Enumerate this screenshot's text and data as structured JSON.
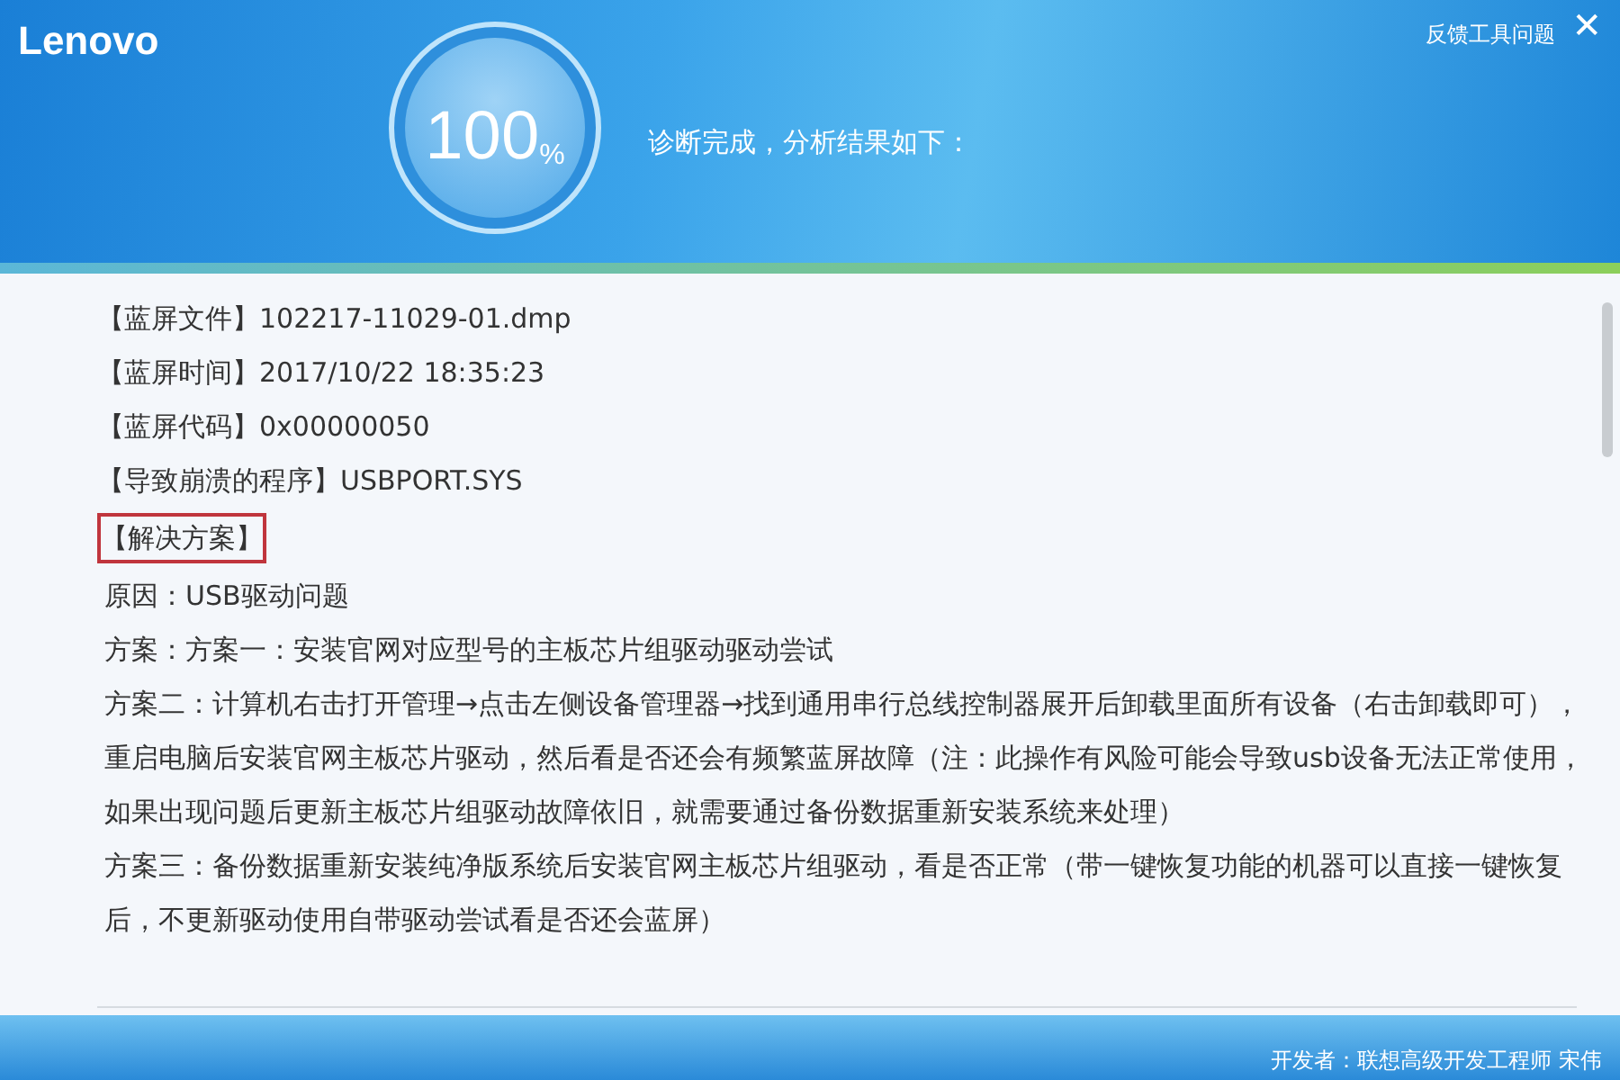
{
  "header": {
    "logo": "Lenovo",
    "progress": {
      "value": "100",
      "unit": "%"
    },
    "status": "诊断完成，分析结果如下：",
    "feedback_link": "反馈工具问题",
    "close": "✕"
  },
  "report": {
    "fields": [
      {
        "label": "【蓝屏文件】",
        "value": "102217-11029-01.dmp"
      },
      {
        "label": "【蓝屏时间】",
        "value": "2017/10/22 18:35:23"
      },
      {
        "label": "【蓝屏代码】",
        "value": "0x00000050"
      },
      {
        "label": "【导致崩溃的程序】",
        "value": "USBPORT.SYS"
      }
    ],
    "solution_heading": {
      "text": "【解决方案】",
      "highlighted": true
    },
    "paragraphs": [
      "原因：USB驱动问题",
      "方案：方案一：安装官网对应型号的主板芯片组驱动驱动尝试",
      "方案二：计算机右击打开管理→点击左侧设备管理器→找到通用串行总线控制器展开后卸载里面所有设备（右击卸载即可），重启电脑后安装官网主板芯片驱动，然后看是否还会有频繁蓝屏故障（注：此操作有风险可能会导致usb设备无法正常使用，如果出现问题后更新主板芯片组驱动故障依旧，就需要通过备份数据重新安装系统来处理）",
      "方案三：备份数据重新安装纯净版系统后安装官网主板芯片组驱动，看是否正常（带一键恢复功能的机器可以直接一键恢复后，不更新驱动使用自带驱动尝试看是否还会蓝屏）"
    ]
  },
  "footer": {
    "developer": "开发者：联想高级开发工程师 宋伟"
  }
}
